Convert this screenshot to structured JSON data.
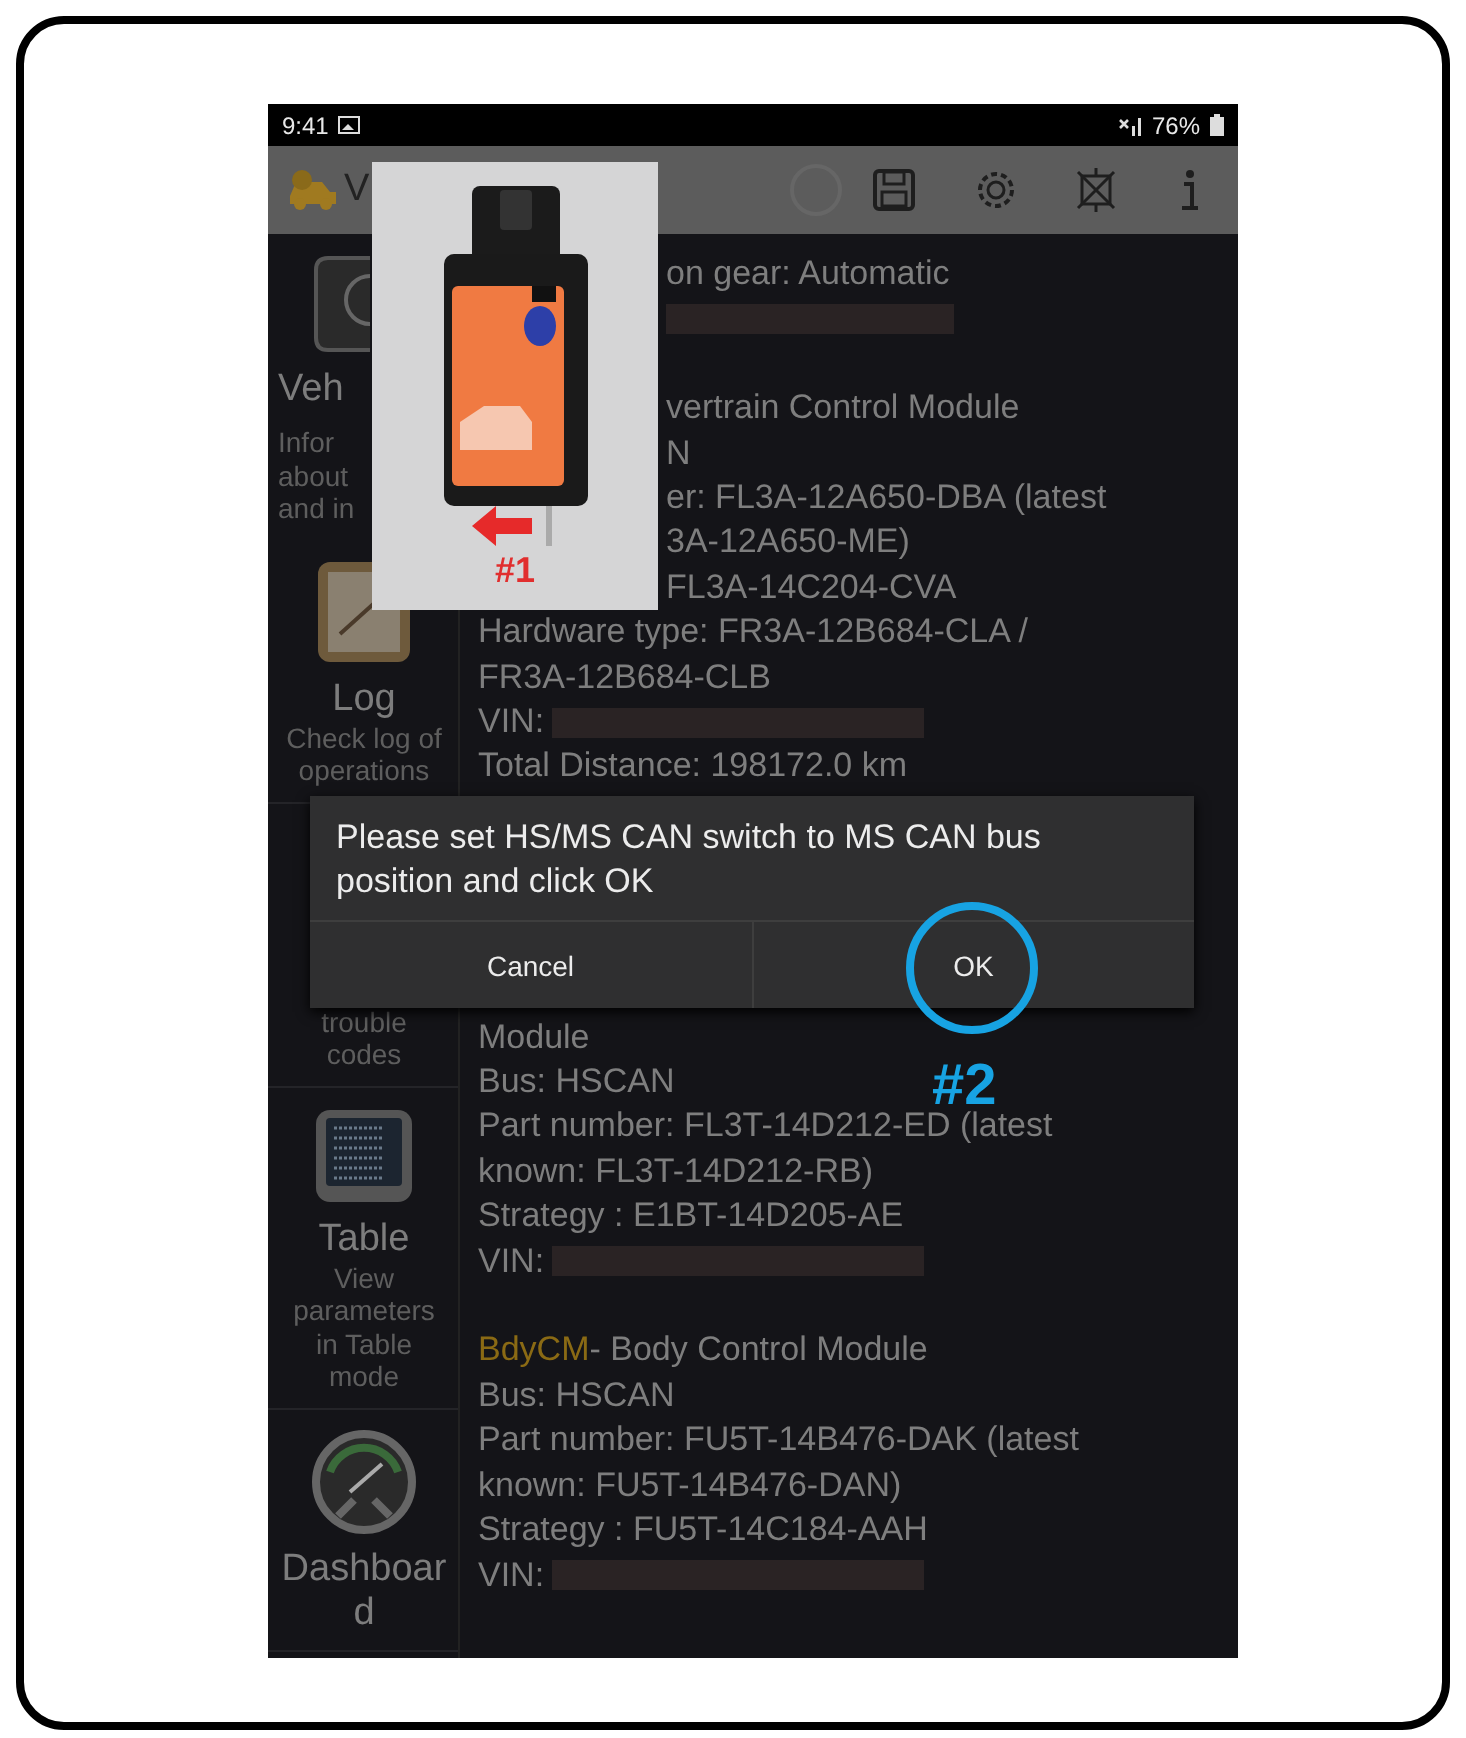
{
  "status_bar": {
    "time": "9:41",
    "battery": "76%"
  },
  "toolbar": {
    "title": "V"
  },
  "sidebar": {
    "items": [
      {
        "kind": "partial",
        "title": "Veh",
        "description": [
          "Infor",
          "about",
          "and in"
        ]
      },
      {
        "kind": "full",
        "title": "Log",
        "description": [
          "Check log of",
          "operations"
        ]
      },
      {
        "kind": "covered",
        "description": [
          "trouble",
          "codes"
        ]
      },
      {
        "kind": "full",
        "title": "Table",
        "description": [
          "View",
          "parameters",
          "in Table",
          "mode"
        ]
      },
      {
        "kind": "full",
        "title": "Dashboard"
      }
    ]
  },
  "content": {
    "groups": [
      [
        {
          "kind": "partial",
          "text": "on gear: Automatic"
        },
        {
          "kind": "bar"
        }
      ],
      [
        {
          "kind": "partial",
          "text": "vertrain Control Module"
        },
        {
          "kind": "partial",
          "text": "N"
        },
        {
          "kind": "partial",
          "text": "er: FL3A-12A650-DBA (latest"
        },
        {
          "kind": "partial",
          "text": "3A-12A650-ME)"
        },
        {
          "kind": "partial",
          "text": "FL3A-14C204-CVA"
        },
        {
          "kind": "text",
          "text": "Hardware type: FR3A-12B684-CLA /"
        },
        {
          "kind": "text",
          "text": "FR3A-12B684-CLB"
        },
        {
          "kind": "vin",
          "text": "VIN:"
        },
        {
          "kind": "text",
          "text": "Total Distance: 198172.0 km"
        }
      ],
      [
        {
          "kind": "text",
          "text": "Module"
        },
        {
          "kind": "text",
          "text": "Bus: HSCAN"
        },
        {
          "kind": "text",
          "text": "Part number: FL3T-14D212-ED (latest"
        },
        {
          "kind": "text",
          "text": "known: FL3T-14D212-RB)"
        },
        {
          "kind": "text",
          "text": "Strategy : E1BT-14D205-AE"
        },
        {
          "kind": "vin",
          "text": "VIN:"
        }
      ],
      [
        {
          "kind": "module",
          "code": "BdyCM",
          "text": " - Body Control Module"
        },
        {
          "kind": "text",
          "text": "Bus: HSCAN"
        },
        {
          "kind": "text",
          "text": "Part number: FU5T-14B476-DAK (latest"
        },
        {
          "kind": "text",
          "text": "known: FU5T-14B476-DAN)"
        },
        {
          "kind": "text",
          "text": "Strategy : FU5T-14C184-AAH"
        },
        {
          "kind": "vin",
          "text": "VIN:"
        }
      ]
    ]
  },
  "dialog": {
    "message": "Please set HS/MS CAN switch to MS CAN bus position and click OK",
    "buttons": [
      "Cancel",
      "OK"
    ]
  },
  "annotations": {
    "photo_label": "#1",
    "button_label": "#2"
  }
}
